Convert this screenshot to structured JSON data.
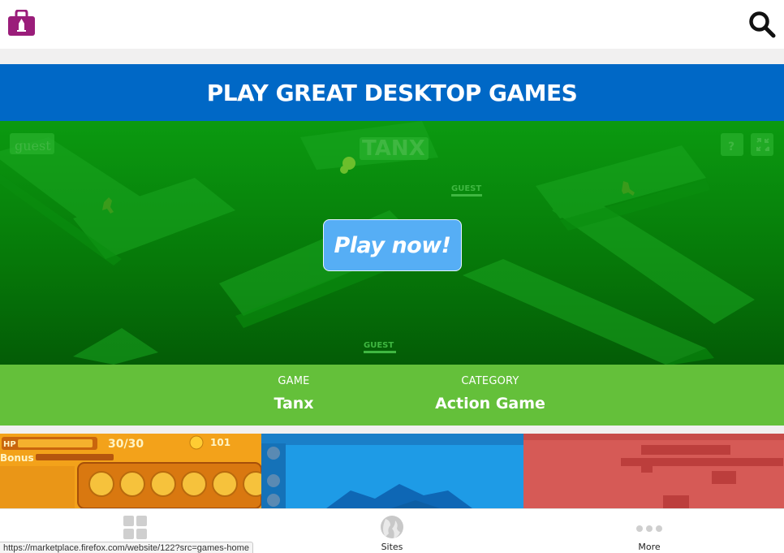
{
  "header": {
    "logo_icon": "marketplace-bag-icon",
    "search_icon": "search-icon"
  },
  "banner": {
    "title": "PLAY GREAT DESKTOP GAMES"
  },
  "hero": {
    "play_button": "Play now!",
    "bg_text": {
      "guest_top": "guest",
      "tanx_logo": "TANX",
      "guest_mid": "GUEST",
      "guest_bottom": "GUEST",
      "help": "?"
    }
  },
  "info": {
    "game_label": "GAME",
    "game_value": "Tanx",
    "category_label": "CATEGORY",
    "category_value": "Action Game"
  },
  "thumbnails": {
    "t1_hp": "HP",
    "t1_score": "30/30",
    "t1_coins": "101",
    "t1_bonus": "Bonus"
  },
  "tabbar": {
    "apps_label": "",
    "sites_label": "Sites",
    "more_label": "More"
  },
  "status_url": "https://marketplace.firefox.com/website/122?src=games-home",
  "colors": {
    "banner": "#0068c6",
    "hero_green": "#0b9a10",
    "info_green": "#64c03a",
    "play_button": "#56aef5",
    "logo_purple": "#9a1d7a"
  }
}
